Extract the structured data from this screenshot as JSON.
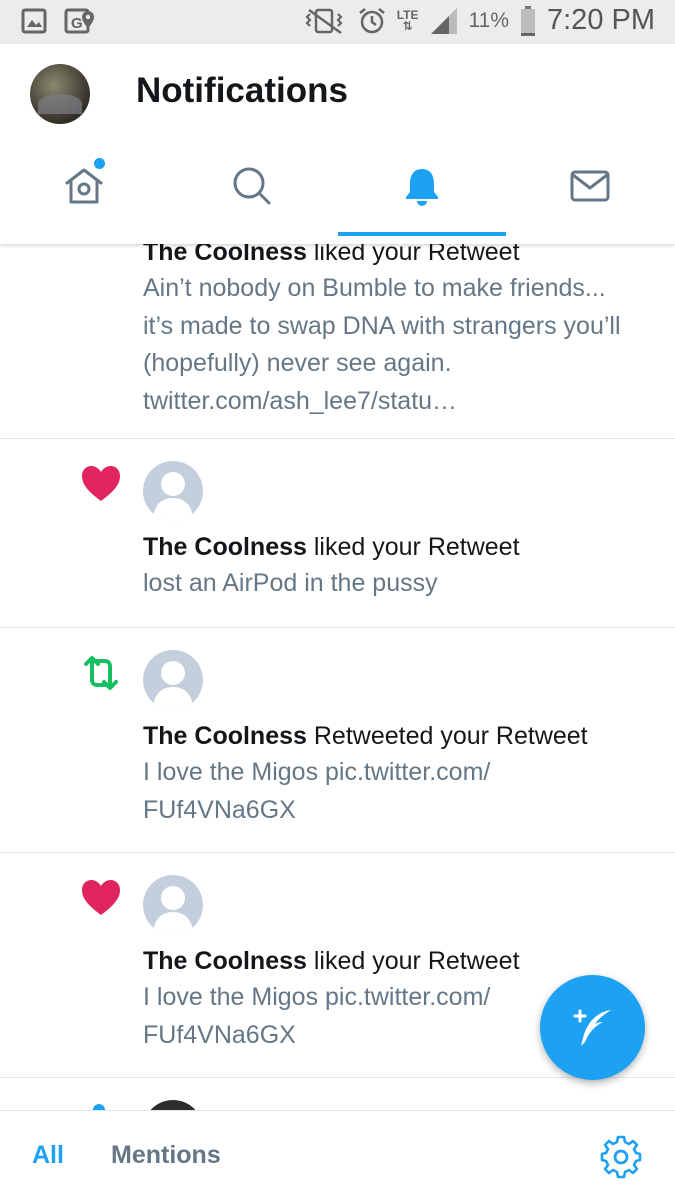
{
  "status_bar": {
    "lte_top": "LTE",
    "battery_pct": "11%",
    "time": "7:20 PM",
    "icons": [
      "gallery-icon",
      "g-location-icon",
      "vibrate-icon",
      "alarm-icon",
      "signal-icon",
      "battery-icon"
    ],
    "battery_level": 0.11
  },
  "header": {
    "title": "Notifications",
    "tabs": [
      {
        "name": "home",
        "icon": "home-icon",
        "has_dot": true
      },
      {
        "name": "search",
        "icon": "search-icon"
      },
      {
        "name": "notifications",
        "icon": "bell-icon",
        "active": true
      },
      {
        "name": "messages",
        "icon": "mail-icon"
      }
    ],
    "accent": "#1da1f2"
  },
  "notifications": [
    {
      "actor": "The Coolness",
      "verb": "liked your Retweet",
      "text": "Ain’t nobody on Bumble to make friends... it’s made to swap DNA with strangers you’ll (hopefully) never see again. twitter.com/ash_lee7/statu…"
    },
    {
      "type": "like",
      "icon": "heart-icon",
      "actor": "The Coolness",
      "verb": "liked your Retweet",
      "text": "lost an AirPod in the pussy"
    },
    {
      "type": "retweet",
      "icon": "retweet-icon",
      "actor": "The Coolness",
      "verb": "Retweeted your Retweet",
      "text": "I love the Migos pic.twitter.com/ FUf4VNa6GX"
    },
    {
      "type": "like",
      "icon": "heart-icon",
      "actor": "The Coolness",
      "verb": "liked your Retweet",
      "text": "I love the Migos pic.twitter.com/ FUf4VNa6GX"
    }
  ],
  "bottom_bar": {
    "tab_all": "All",
    "tab_mentions": "Mentions",
    "settings_icon": "gear-icon"
  },
  "fab": {
    "icon": "compose-tweet-icon"
  },
  "colors": {
    "like": "#e0245e",
    "retweet": "#17bf63",
    "secondary_text": "#657786"
  }
}
